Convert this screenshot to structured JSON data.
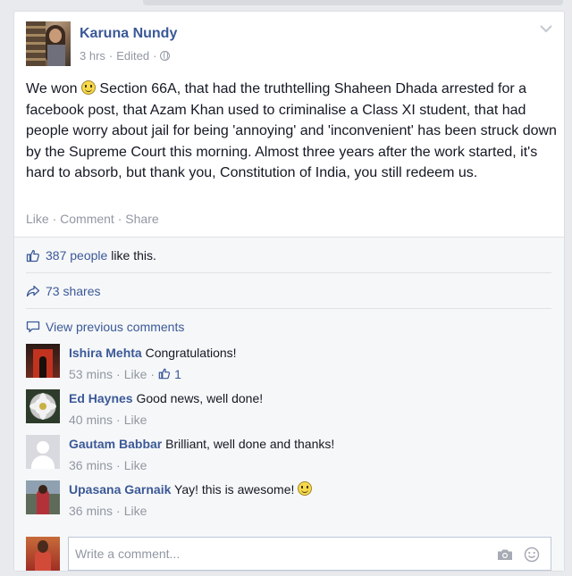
{
  "post": {
    "author": "Karuna Nundy",
    "time": "3 hrs",
    "edited": "Edited",
    "text_before_emoji": "We won",
    "text_after_emoji": " Section 66A, that had the truthtelling Shaheen Dhada arrested for a facebook post, that Azam Khan used to criminalise a Class XI student, that had people worry about jail for being 'annoying' and 'inconvenient' has been struck down by the Supreme Court this morning. Almost three years after the work started, it's hard to absorb, but thank you, Constitution of India, you still redeem us.",
    "actions": {
      "like": "Like",
      "comment": "Comment",
      "share": "Share"
    }
  },
  "ufi": {
    "likes_link": "387 people",
    "likes_suffix": "like this.",
    "shares": "73 shares",
    "view_previous": "View previous comments"
  },
  "comments": [
    {
      "name": "Ishira Mehta",
      "text": "Congratulations!",
      "time": "53 mins",
      "like": "Like",
      "like_count": "1"
    },
    {
      "name": "Ed Haynes",
      "text": "Good news, well done!",
      "time": "40 mins",
      "like": "Like"
    },
    {
      "name": "Gautam Babbar",
      "text": "Brilliant, well done and thanks!",
      "time": "36 mins",
      "like": "Like"
    },
    {
      "name": "Upasana Garnaik",
      "text": "Yay! this is awesome!",
      "time": "36 mins",
      "like": "Like"
    }
  ],
  "composer": {
    "placeholder": "Write a comment..."
  },
  "icons": {
    "thumb": "thumbs-up-icon",
    "share": "share-arrow-icon",
    "comment": "speech-bubble-icon",
    "camera": "camera-icon",
    "emoticon": "emoticon-icon",
    "globe": "globe-icon",
    "chevron": "chevron-down-icon"
  },
  "colors": {
    "link": "#3b5998",
    "muted": "#9197a3",
    "text": "#141823",
    "ufi_bg": "#f6f7f8"
  }
}
